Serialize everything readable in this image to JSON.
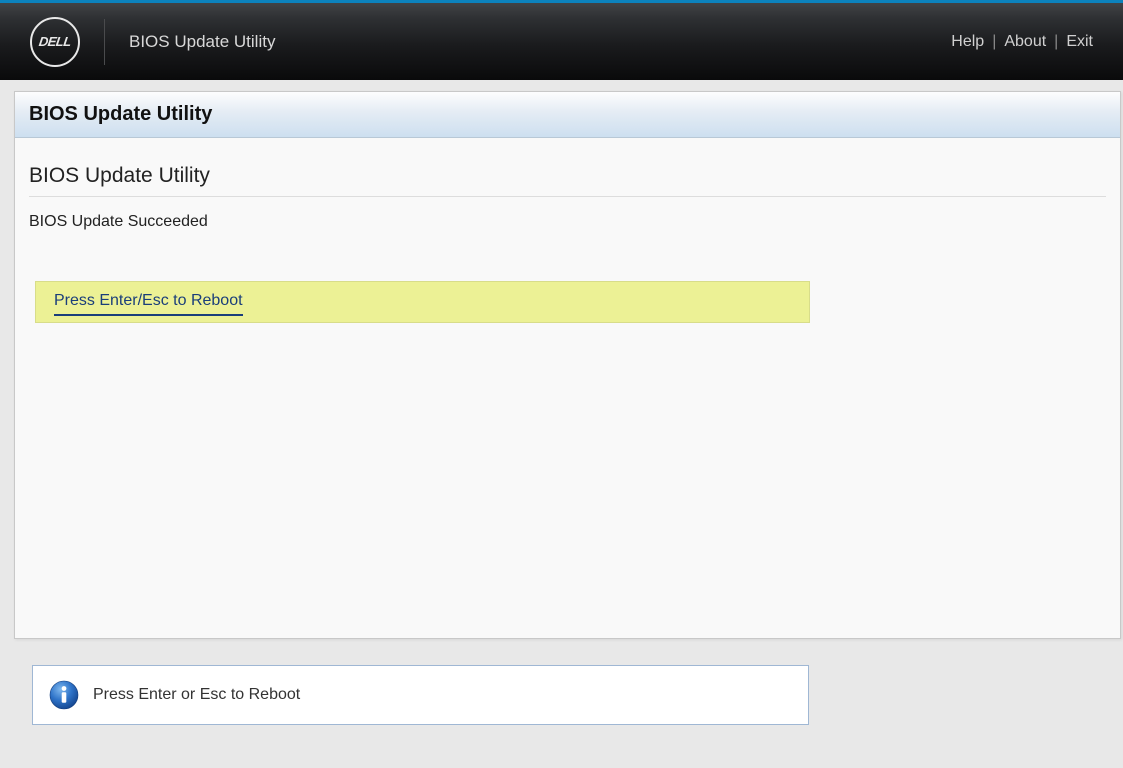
{
  "header": {
    "logo_text": "DELL",
    "app_title": "BIOS Update Utility",
    "nav": {
      "help": "Help",
      "about": "About",
      "exit": "Exit"
    }
  },
  "panel": {
    "header": "BIOS Update Utility",
    "section_title": "BIOS Update Utility",
    "status_message": "BIOS Update Succeeded",
    "reboot_prompt": "Press Enter/Esc to Reboot"
  },
  "info": {
    "message": "Press Enter or Esc to Reboot"
  }
}
